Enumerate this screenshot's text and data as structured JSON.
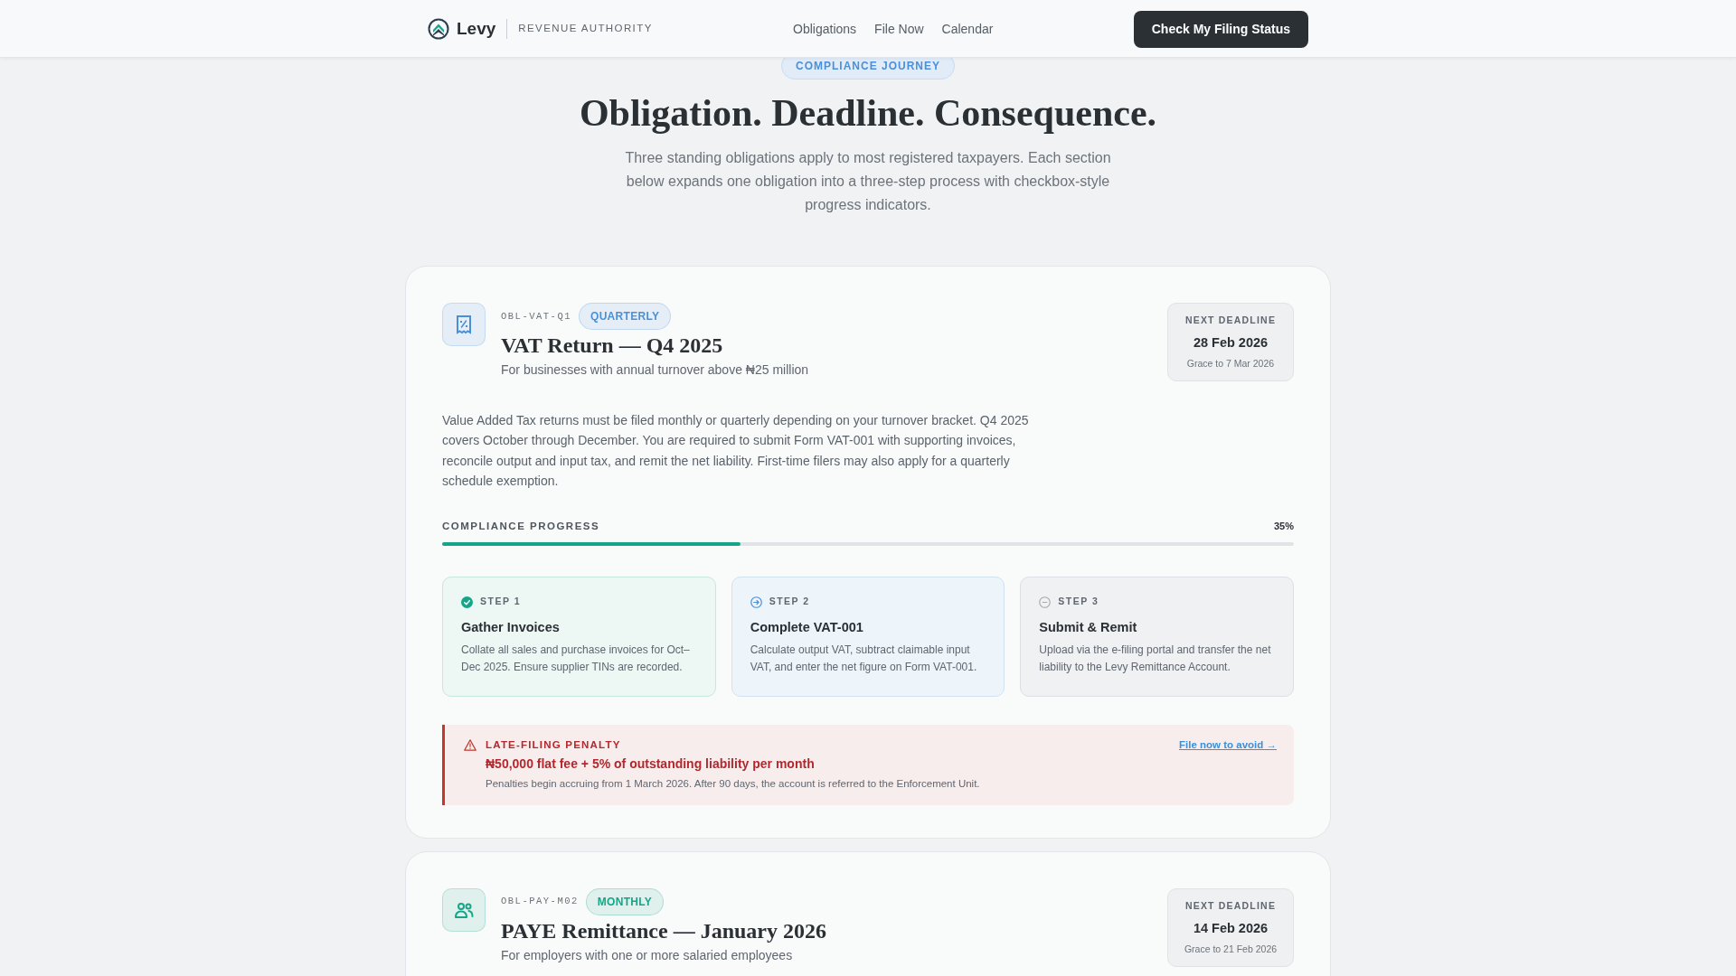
{
  "header": {
    "brand": "Levy",
    "tagline": "REVENUE AUTHORITY",
    "nav": [
      {
        "label": "Obligations"
      },
      {
        "label": "File Now"
      },
      {
        "label": "Calendar"
      }
    ],
    "cta": "Check My Filing Status"
  },
  "hero": {
    "eyebrow": "COMPLIANCE JOURNEY",
    "title": "Obligation. Deadline. Consequence.",
    "intro": "Three standing obligations apply to most registered taxpayers. Each section below expands one obligation into a three-step process with checkbox-style progress indicators."
  },
  "obligations": [
    {
      "kind": "vat",
      "color": "#4a90d9",
      "code": "OBL-VAT-Q1",
      "frequency": "QUARTERLY",
      "title": "VAT Return — Q4 2025",
      "audience": "For businesses with annual turnover above ₦25 million",
      "deadline": {
        "label": "NEXT DEADLINE",
        "date": "28 Feb 2026",
        "grace": "Grace to 7 Mar 2026"
      },
      "description": "Value Added Tax returns must be filed monthly or quarterly depending on your turnover bracket. Q4 2025 covers October through December. You are required to submit Form VAT-001 with supporting invoices, reconcile output and input tax, and remit the net liability. First-time filers may also apply for a quarterly schedule exemption.",
      "progress": {
        "label": "COMPLIANCE PROGRESS",
        "reading": "35%",
        "level": 0.35
      },
      "steps": [
        {
          "kind": "done",
          "label": "STEP 1",
          "title": "Gather Invoices",
          "text": "Collate all sales and purchase invoices for Oct–Dec 2025. Ensure supplier TINs are recorded."
        },
        {
          "kind": "current",
          "label": "STEP 2",
          "title": "Complete VAT-001",
          "text": "Calculate output VAT, subtract claimable input VAT, and enter the net figure on Form VAT-001."
        },
        {
          "kind": "pending",
          "label": "STEP 3",
          "title": "Submit & Remit",
          "text": "Upload via the e-filing portal and transfer the net liability to the Levy Remittance Account."
        }
      ],
      "penalty": {
        "label": "LATE-FILING PENALTY",
        "summary": "₦50,000 flat fee + 5% of outstanding liability per month",
        "detail": "Penalties begin accruing from 1 March 2026. After 90 days, the account is referred to the Enforcement Unit.",
        "link": "File now to avoid →"
      }
    },
    {
      "kind": "payroll",
      "color": "#17a589",
      "code": "OBL-PAY-M02",
      "frequency": "MONTHLY",
      "title": "PAYE Remittance — January 2026",
      "audience": "For employers with one or more salaried employees",
      "deadline": {
        "label": "NEXT DEADLINE",
        "date": "14 Feb 2026",
        "grace": "Grace to 21 Feb 2026"
      }
    }
  ]
}
